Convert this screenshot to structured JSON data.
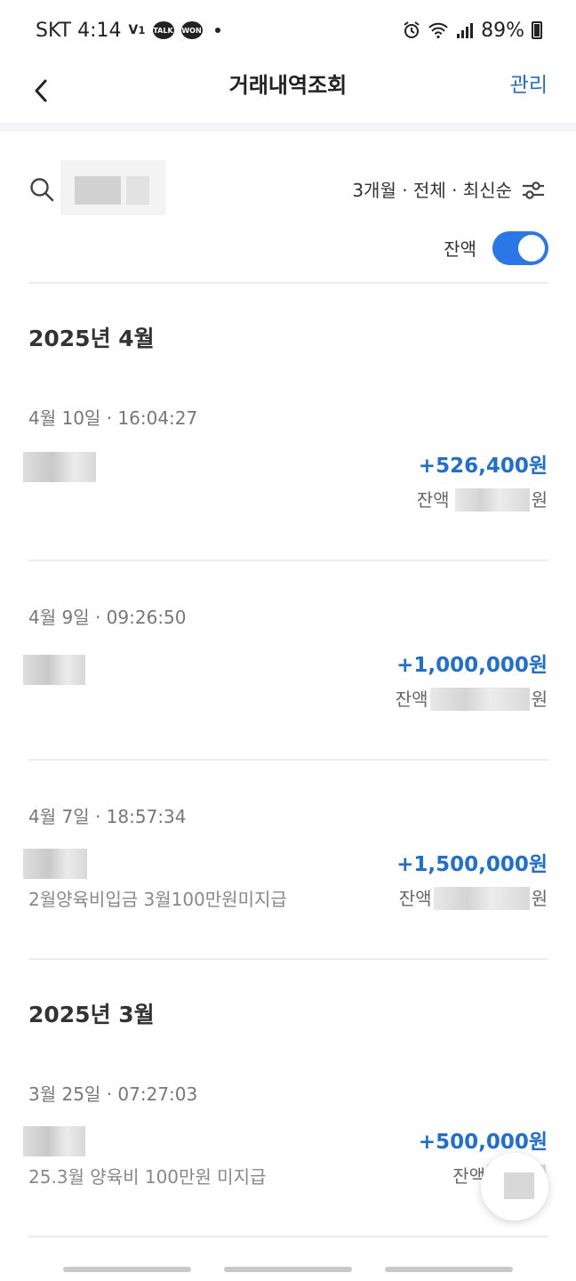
{
  "status_bar": {
    "carrier_time": "SKT 4:14",
    "battery": "89%",
    "icons": [
      "volte-icon",
      "talk-icon",
      "won-icon",
      "alarm-icon",
      "wifi-icon",
      "signal-icon",
      "battery-icon"
    ]
  },
  "header": {
    "title": "거래내역조회",
    "manage_label": "관리"
  },
  "filter": {
    "summary": "3개월 · 전체 · 최신순",
    "balance_toggle_label": "잔액",
    "balance_toggle_on": true
  },
  "months": [
    {
      "label": "2025년 4월",
      "transactions": [
        {
          "datetime": "4월 10일 · 16:04:27",
          "amount": "+526,400원",
          "balance_prefix": "잔액",
          "balance_suffix": "원",
          "memo": ""
        },
        {
          "datetime": "4월 9일 · 09:26:50",
          "amount": "+1,000,000원",
          "balance_prefix": "잔액",
          "balance_suffix": "원",
          "memo": ""
        },
        {
          "datetime": "4월 7일 · 18:57:34",
          "amount": "+1,500,000원",
          "balance_prefix": "잔액",
          "balance_suffix": "원",
          "memo": "2월양육비입금 3월100만원미지급"
        }
      ]
    },
    {
      "label": "2025년 3월",
      "transactions": [
        {
          "datetime": "3월 25일 · 07:27:03",
          "amount": "+500,000원",
          "balance_prefix": "잔액",
          "balance_suffix": "원",
          "memo": "25.3월 양육비 100만원 미지급"
        }
      ]
    }
  ],
  "colors": {
    "accent": "#1f6fd1",
    "toggle": "#2a77e8"
  }
}
